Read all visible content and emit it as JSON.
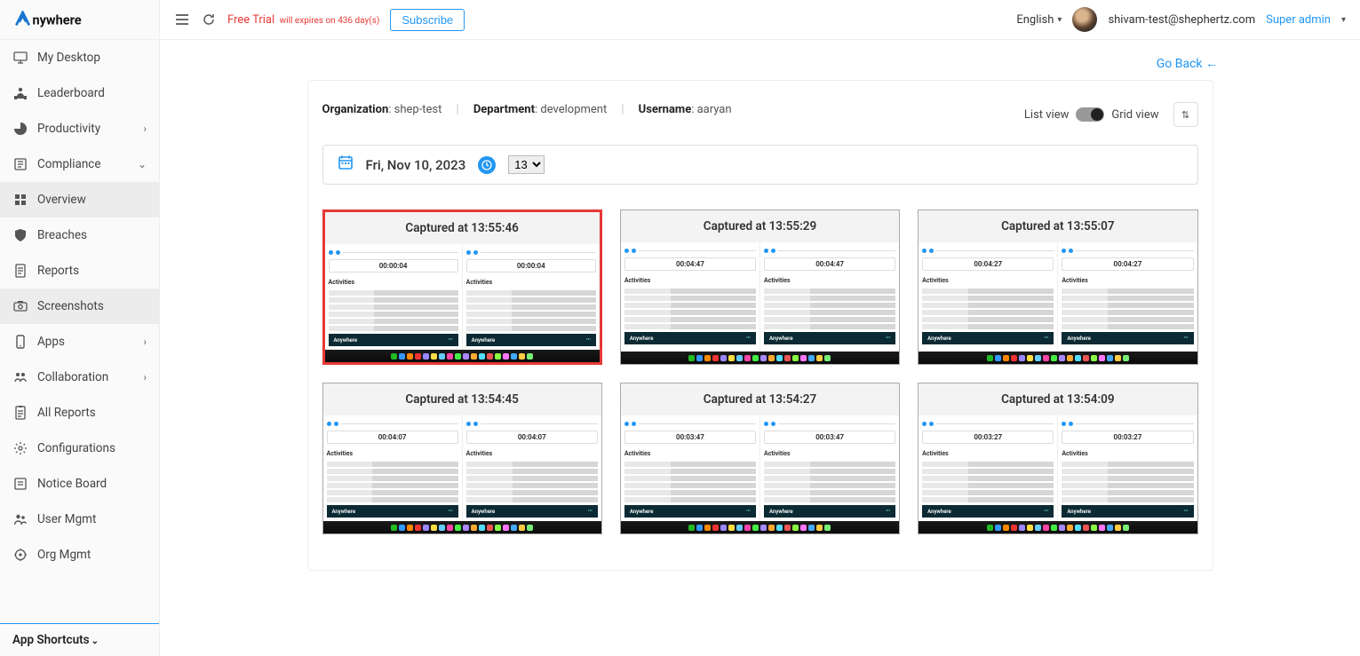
{
  "app": {
    "name": "Anywhere"
  },
  "topbar": {
    "trial_label": "Free Trial",
    "trial_sub": "will expires on 436 day(s)",
    "subscribe": "Subscribe",
    "language": "English",
    "email": "shivam-test@shephertz.com",
    "role": "Super admin"
  },
  "sidebar": {
    "items": [
      {
        "label": "My Desktop",
        "icon": "desktop-icon"
      },
      {
        "label": "Leaderboard",
        "icon": "leaderboard-icon"
      },
      {
        "label": "Productivity",
        "icon": "pie-icon",
        "expandable": true,
        "chev": "›"
      },
      {
        "label": "Compliance",
        "icon": "compliance-icon",
        "expandable": true,
        "chev": "⌄"
      },
      {
        "label": "Overview",
        "icon": "grid-icon",
        "indent": true,
        "active": true
      },
      {
        "label": "Breaches",
        "icon": "shield-icon",
        "indent": true
      },
      {
        "label": "Reports",
        "icon": "reports-icon",
        "indent": true
      },
      {
        "label": "Screenshots",
        "icon": "screenshot-icon",
        "indent": true,
        "active": true
      },
      {
        "label": "Apps",
        "icon": "phone-icon",
        "expandable": true,
        "chev": "›"
      },
      {
        "label": "Collaboration",
        "icon": "collab-icon",
        "expandable": true,
        "chev": "›"
      },
      {
        "label": "All Reports",
        "icon": "allreports-icon"
      },
      {
        "label": "Configurations",
        "icon": "gear-icon"
      },
      {
        "label": "Notice Board",
        "icon": "notice-icon"
      },
      {
        "label": "User Mgmt",
        "icon": "users-icon"
      },
      {
        "label": "Org Mgmt",
        "icon": "orgmgmt-icon"
      }
    ],
    "shortcuts": "App Shortcuts"
  },
  "page": {
    "go_back": "Go Back",
    "crumbs": {
      "org_label": "Organization",
      "org_value": "shep-test",
      "dept_label": "Department",
      "dept_value": "development",
      "user_label": "Username",
      "user_value": "aaryan"
    },
    "view": {
      "list": "List view",
      "grid": "Grid view"
    },
    "date": "Fri, Nov 10, 2023",
    "hour": "13",
    "cards": [
      {
        "title": "Captured at 13:55:46",
        "timer": "00:00:04",
        "highlight": true
      },
      {
        "title": "Captured at 13:55:29",
        "timer": "00:04:47"
      },
      {
        "title": "Captured at 13:55:07",
        "timer": "00:04:27"
      },
      {
        "title": "Captured at 13:54:45",
        "timer": "00:04:07"
      },
      {
        "title": "Captured at 13:54:27",
        "timer": "00:03:47"
      },
      {
        "title": "Captured at 13:54:09",
        "timer": "00:03:27"
      }
    ],
    "thumb": {
      "activities": "Activities",
      "brand": "Anywhere"
    },
    "taskbar_colors": [
      "#2b2",
      "#39f",
      "#f80",
      "#e33",
      "#98f",
      "#fd4",
      "#6cf",
      "#f4a",
      "#4e4",
      "#a8f",
      "#fa3",
      "#5df",
      "#e55",
      "#8f4",
      "#f7f",
      "#4af",
      "#fc4",
      "#7e7"
    ]
  }
}
